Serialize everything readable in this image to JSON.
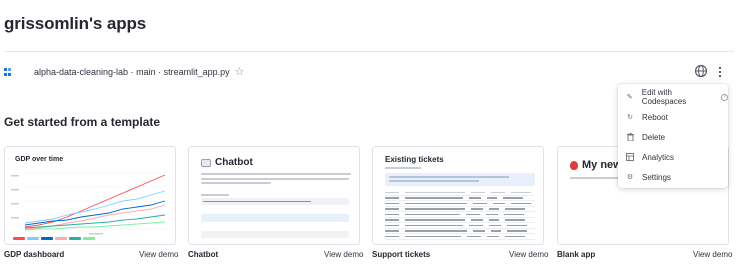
{
  "header": {
    "title": "grissomlin's apps"
  },
  "app": {
    "name": "alpha-data-cleaning-lab · main · streamlit_app.py"
  },
  "icons": {
    "star": "star-icon",
    "globe": "globe-icon",
    "more": "kebab-menu-icon"
  },
  "section": {
    "title": "Get started from a template"
  },
  "templates": [
    {
      "label": "GDP dashboard",
      "demo": "View demo",
      "preview_title": "GDP over time"
    },
    {
      "label": "Chatbot",
      "demo": "View demo",
      "preview_title": "Chatbot"
    },
    {
      "label": "Support tickets",
      "demo": "View demo",
      "preview_title": "Existing tickets"
    },
    {
      "label": "Blank app",
      "demo": "View demo",
      "preview_title": "My new"
    }
  ],
  "menu": {
    "items": [
      {
        "label": "Edit with Codespaces",
        "icon": "pencil-icon"
      },
      {
        "label": "Reboot",
        "icon": "reboot-icon"
      },
      {
        "label": "Delete",
        "icon": "trash-icon"
      },
      {
        "label": "Analytics",
        "icon": "analytics-icon"
      },
      {
        "label": "Settings",
        "icon": "gear-icon"
      }
    ]
  },
  "colors": {
    "accent": "#1c6fe0",
    "balloon": "#e03b3b"
  }
}
